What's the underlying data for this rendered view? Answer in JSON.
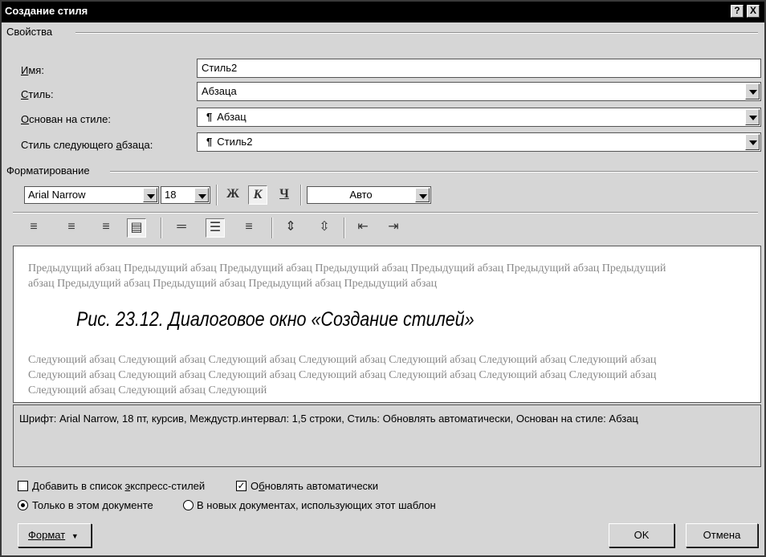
{
  "window": {
    "title": "Создание стиля",
    "help_btn": "?",
    "close_btn": "X"
  },
  "properties": {
    "section_label": "Свойства",
    "name": {
      "label": "Имя:",
      "value": "Стиль2"
    },
    "style_type": {
      "label": "Стиль:",
      "value": "Абзаца"
    },
    "based_on": {
      "label": "Основан на стиле:",
      "value": "Абзац",
      "icon": "paragraph-mark"
    },
    "next_style": {
      "label": "Стиль следующего абзаца:",
      "value": "Стиль2",
      "icon": "paragraph-mark"
    }
  },
  "formatting": {
    "section_label": "Форматирование",
    "font": "Arial Narrow",
    "size": "18",
    "bold": "Ж",
    "italic": "К",
    "underline": "Ч",
    "color": "Авто",
    "italic_pressed": true,
    "alignment_selected": "justify",
    "line_spacing_selected": "1.5"
  },
  "preview": {
    "previous_text": "Предыдущий абзац Предыдущий абзац Предыдущий абзац Предыдущий абзац Предыдущий абзац Предыдущий абзац Предыдущий абзац Предыдущий абзац Предыдущий абзац Предыдущий абзац Предыдущий абзац",
    "sample_text": "Рис. 23.12. Диалоговое окно «Создание стилей»",
    "following_text": "Следующий абзац Следующий абзац Следующий абзац Следующий абзац Следующий абзац Следующий абзац Следующий абзац Следующий абзац Следующий абзац Следующий абзац Следующий абзац Следующий абзац Следующий абзац Следующий абзац Следующий абзац Следующий абзац Следующий"
  },
  "description": "Шрифт: Arial Narrow, 18 пт, курсив, Междустр.интервал:  1,5 строки, Стиль: Обновлять автоматически, Основан на стиле: Абзац",
  "options": {
    "add_quick_styles": {
      "label": "Добавить в список экспресс-стилей",
      "checked": false
    },
    "auto_update": {
      "label": "Обновлять автоматически",
      "checked": true
    },
    "only_this_doc": {
      "label": "Только в этом документе",
      "selected": true
    },
    "new_docs": {
      "label": "В новых документах, использующих этот шаблон",
      "selected": false
    }
  },
  "buttons": {
    "format": "Формат",
    "ok": "OK",
    "cancel": "Отмена"
  }
}
